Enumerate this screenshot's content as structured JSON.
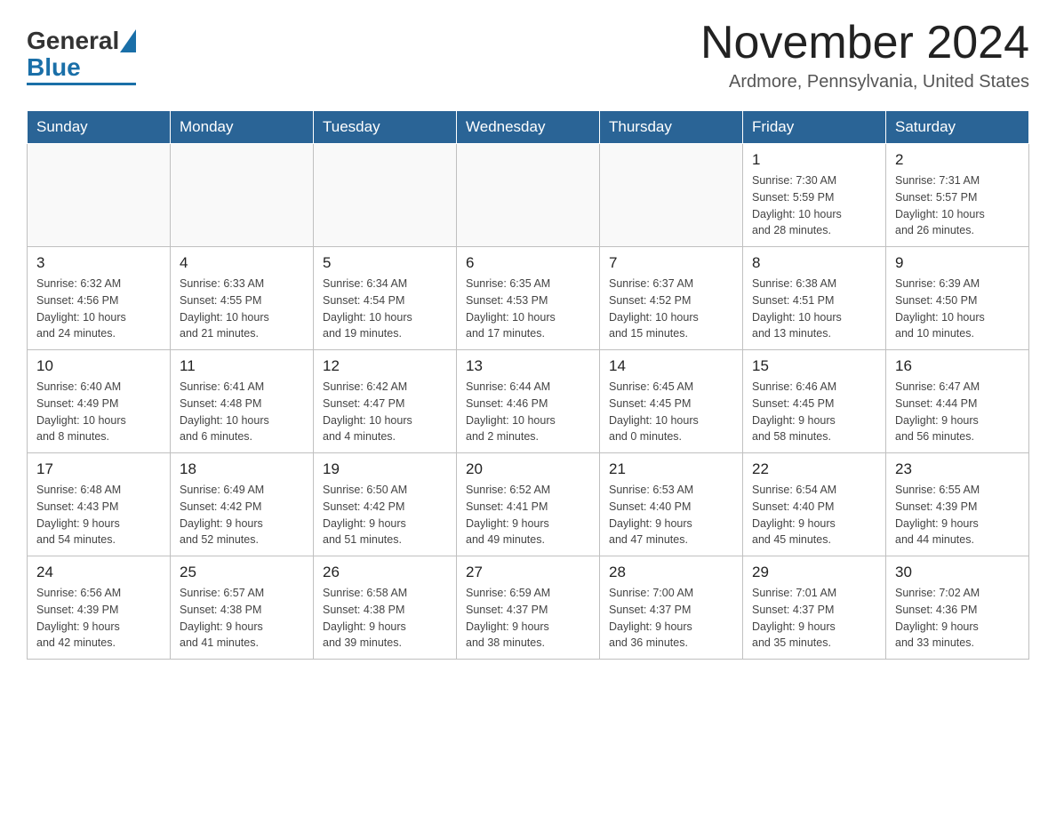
{
  "header": {
    "logo_general": "General",
    "logo_blue": "Blue",
    "month_title": "November 2024",
    "location": "Ardmore, Pennsylvania, United States"
  },
  "weekdays": [
    "Sunday",
    "Monday",
    "Tuesday",
    "Wednesday",
    "Thursday",
    "Friday",
    "Saturday"
  ],
  "weeks": [
    [
      {
        "day": "",
        "info": ""
      },
      {
        "day": "",
        "info": ""
      },
      {
        "day": "",
        "info": ""
      },
      {
        "day": "",
        "info": ""
      },
      {
        "day": "",
        "info": ""
      },
      {
        "day": "1",
        "info": "Sunrise: 7:30 AM\nSunset: 5:59 PM\nDaylight: 10 hours\nand 28 minutes."
      },
      {
        "day": "2",
        "info": "Sunrise: 7:31 AM\nSunset: 5:57 PM\nDaylight: 10 hours\nand 26 minutes."
      }
    ],
    [
      {
        "day": "3",
        "info": "Sunrise: 6:32 AM\nSunset: 4:56 PM\nDaylight: 10 hours\nand 24 minutes."
      },
      {
        "day": "4",
        "info": "Sunrise: 6:33 AM\nSunset: 4:55 PM\nDaylight: 10 hours\nand 21 minutes."
      },
      {
        "day": "5",
        "info": "Sunrise: 6:34 AM\nSunset: 4:54 PM\nDaylight: 10 hours\nand 19 minutes."
      },
      {
        "day": "6",
        "info": "Sunrise: 6:35 AM\nSunset: 4:53 PM\nDaylight: 10 hours\nand 17 minutes."
      },
      {
        "day": "7",
        "info": "Sunrise: 6:37 AM\nSunset: 4:52 PM\nDaylight: 10 hours\nand 15 minutes."
      },
      {
        "day": "8",
        "info": "Sunrise: 6:38 AM\nSunset: 4:51 PM\nDaylight: 10 hours\nand 13 minutes."
      },
      {
        "day": "9",
        "info": "Sunrise: 6:39 AM\nSunset: 4:50 PM\nDaylight: 10 hours\nand 10 minutes."
      }
    ],
    [
      {
        "day": "10",
        "info": "Sunrise: 6:40 AM\nSunset: 4:49 PM\nDaylight: 10 hours\nand 8 minutes."
      },
      {
        "day": "11",
        "info": "Sunrise: 6:41 AM\nSunset: 4:48 PM\nDaylight: 10 hours\nand 6 minutes."
      },
      {
        "day": "12",
        "info": "Sunrise: 6:42 AM\nSunset: 4:47 PM\nDaylight: 10 hours\nand 4 minutes."
      },
      {
        "day": "13",
        "info": "Sunrise: 6:44 AM\nSunset: 4:46 PM\nDaylight: 10 hours\nand 2 minutes."
      },
      {
        "day": "14",
        "info": "Sunrise: 6:45 AM\nSunset: 4:45 PM\nDaylight: 10 hours\nand 0 minutes."
      },
      {
        "day": "15",
        "info": "Sunrise: 6:46 AM\nSunset: 4:45 PM\nDaylight: 9 hours\nand 58 minutes."
      },
      {
        "day": "16",
        "info": "Sunrise: 6:47 AM\nSunset: 4:44 PM\nDaylight: 9 hours\nand 56 minutes."
      }
    ],
    [
      {
        "day": "17",
        "info": "Sunrise: 6:48 AM\nSunset: 4:43 PM\nDaylight: 9 hours\nand 54 minutes."
      },
      {
        "day": "18",
        "info": "Sunrise: 6:49 AM\nSunset: 4:42 PM\nDaylight: 9 hours\nand 52 minutes."
      },
      {
        "day": "19",
        "info": "Sunrise: 6:50 AM\nSunset: 4:42 PM\nDaylight: 9 hours\nand 51 minutes."
      },
      {
        "day": "20",
        "info": "Sunrise: 6:52 AM\nSunset: 4:41 PM\nDaylight: 9 hours\nand 49 minutes."
      },
      {
        "day": "21",
        "info": "Sunrise: 6:53 AM\nSunset: 4:40 PM\nDaylight: 9 hours\nand 47 minutes."
      },
      {
        "day": "22",
        "info": "Sunrise: 6:54 AM\nSunset: 4:40 PM\nDaylight: 9 hours\nand 45 minutes."
      },
      {
        "day": "23",
        "info": "Sunrise: 6:55 AM\nSunset: 4:39 PM\nDaylight: 9 hours\nand 44 minutes."
      }
    ],
    [
      {
        "day": "24",
        "info": "Sunrise: 6:56 AM\nSunset: 4:39 PM\nDaylight: 9 hours\nand 42 minutes."
      },
      {
        "day": "25",
        "info": "Sunrise: 6:57 AM\nSunset: 4:38 PM\nDaylight: 9 hours\nand 41 minutes."
      },
      {
        "day": "26",
        "info": "Sunrise: 6:58 AM\nSunset: 4:38 PM\nDaylight: 9 hours\nand 39 minutes."
      },
      {
        "day": "27",
        "info": "Sunrise: 6:59 AM\nSunset: 4:37 PM\nDaylight: 9 hours\nand 38 minutes."
      },
      {
        "day": "28",
        "info": "Sunrise: 7:00 AM\nSunset: 4:37 PM\nDaylight: 9 hours\nand 36 minutes."
      },
      {
        "day": "29",
        "info": "Sunrise: 7:01 AM\nSunset: 4:37 PM\nDaylight: 9 hours\nand 35 minutes."
      },
      {
        "day": "30",
        "info": "Sunrise: 7:02 AM\nSunset: 4:36 PM\nDaylight: 9 hours\nand 33 minutes."
      }
    ]
  ]
}
